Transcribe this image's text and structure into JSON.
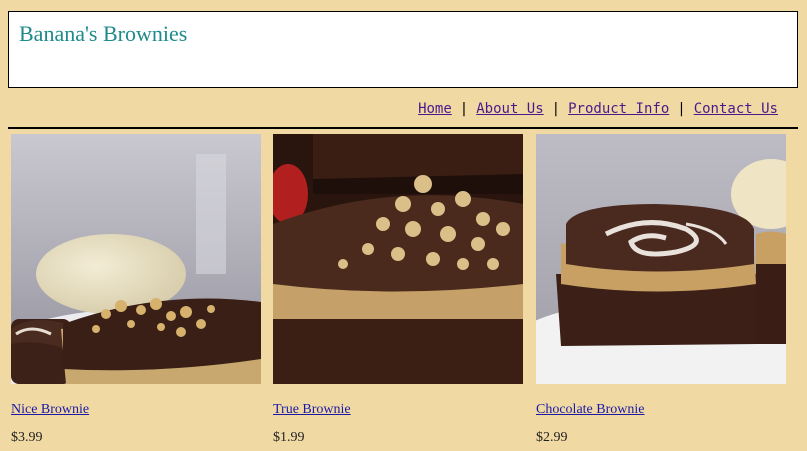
{
  "header": {
    "title": "Banana's Brownies",
    "background": "#ffffff",
    "title_color": "#1e8a8a"
  },
  "nav": {
    "items": [
      {
        "label": "Home"
      },
      {
        "label": "About Us"
      },
      {
        "label": "Product Info"
      },
      {
        "label": "Contact Us"
      }
    ],
    "separator": "|",
    "link_color": "#4b1a8a"
  },
  "products": [
    {
      "name": "Nice Brownie",
      "price": "$3.99",
      "image": "brownie-with-nuts-photo"
    },
    {
      "name": "True Brownie",
      "price": "$1.99",
      "image": "brownie-closeup-nuts-photo"
    },
    {
      "name": "Chocolate Brownie",
      "price": "$2.99",
      "image": "brownie-swirl-peanut-butter-photo"
    }
  ],
  "colors": {
    "page_background": "#f1d9a4",
    "product_link": "#1a1aa6"
  }
}
